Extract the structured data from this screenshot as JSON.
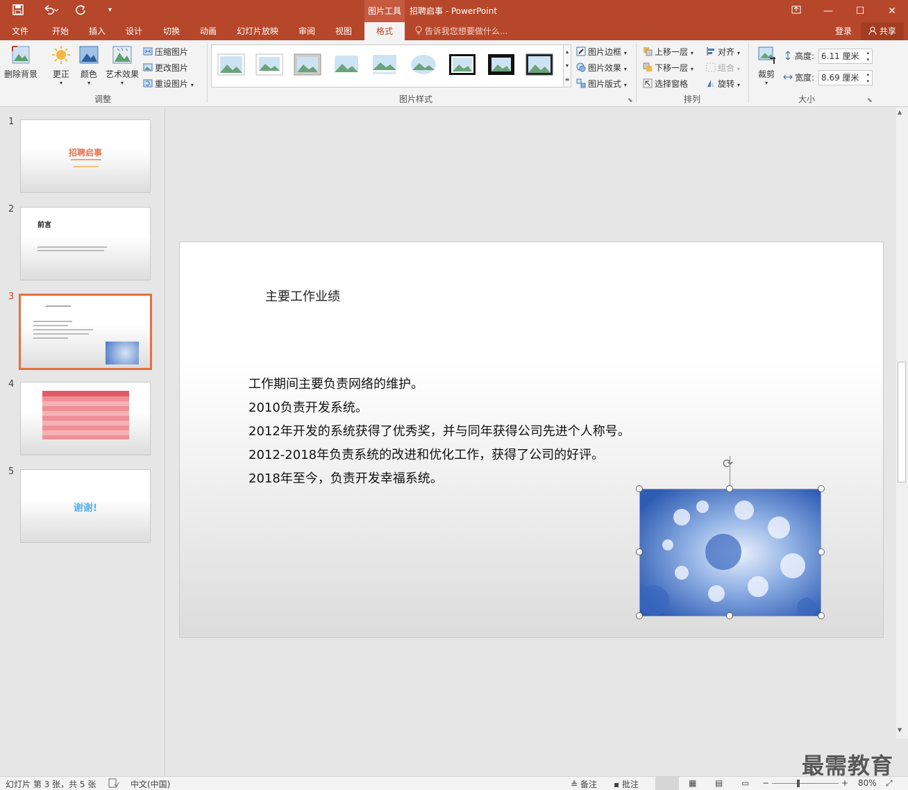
{
  "titlebar": {
    "context_group": "图片工具",
    "doc_title": "招聘启事 - PowerPoint",
    "icons": [
      "save-icon",
      "undo-icon",
      "redo-icon",
      "customize-icon"
    ],
    "window_buttons": [
      "restore-ribbon-icon",
      "minimize-icon",
      "maximize-icon",
      "close-icon"
    ]
  },
  "tabs": {
    "items": [
      "文件",
      "开始",
      "插入",
      "设计",
      "切换",
      "动画",
      "幻灯片放映",
      "审阅",
      "视图",
      "格式"
    ],
    "active": "格式",
    "tell_me": "告诉我您想要做什么...",
    "login": "登录",
    "share": "共享"
  },
  "ribbon": {
    "adjust": {
      "remove_bg": "删除背景",
      "corrections": "更正",
      "color": "颜色",
      "artistic": "艺术效果",
      "compress": "压缩图片",
      "change": "更改图片",
      "reset": "重设图片",
      "label": "调整"
    },
    "styles": {
      "label": "图片样式",
      "border": "图片边框",
      "effects": "图片效果",
      "layout": "图片版式"
    },
    "arrange": {
      "label": "排列",
      "bring_forward": "上移一层",
      "send_backward": "下移一层",
      "selection_pane": "选择窗格",
      "align": "对齐",
      "group": "组合",
      "rotate": "旋转"
    },
    "size": {
      "label": "大小",
      "crop": "裁剪",
      "height_label": "高度:",
      "height_value": "6.11 厘米",
      "width_label": "宽度:",
      "width_value": "8.69 厘米"
    }
  },
  "slides": {
    "numbers": [
      "1",
      "2",
      "3",
      "4",
      "5"
    ],
    "s1_title": "招聘启事",
    "s2_title": "前言",
    "s5_title": "谢谢!"
  },
  "slide": {
    "title": "主要工作业绩",
    "lines": [
      "工作期间主要负责网络的维护。",
      "2010负责开发系统。",
      "2012年开发的系统获得了优秀奖，并与同年获得公司先进个人称号。",
      "2012-2018年负责系统的改进和优化工作，获得了公司的好评。",
      "2018年至今，负责开发幸福系统。"
    ]
  },
  "status": {
    "slide_info": "幻灯片 第 3 张，共 5 张",
    "language": "中文(中国)",
    "notes": "备注",
    "comments": "批注",
    "zoom": "80%"
  },
  "watermark": "最需教育",
  "colors": {
    "accent": "#b7472a",
    "selected_thumb": "#e3703f",
    "picture_blue": "#3f6cc0"
  }
}
